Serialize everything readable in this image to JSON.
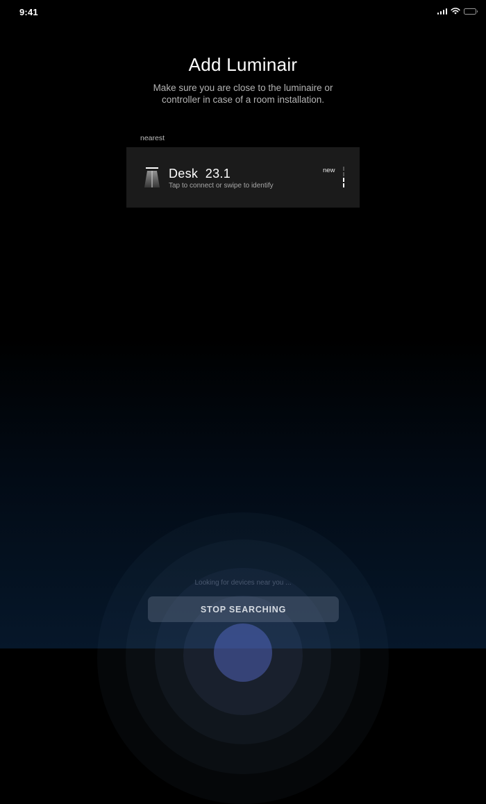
{
  "status_bar": {
    "time": "9:41",
    "icons": [
      "cellular-signal-icon",
      "wifi-icon",
      "battery-icon"
    ]
  },
  "header": {
    "title": "Add Luminair",
    "subtitle": "Make sure you are close to the luminaire or controller in case of a room installation."
  },
  "devices": {
    "section_label": "nearest",
    "items": [
      {
        "name": "Desk  23.1",
        "hint": "Tap to connect or swipe to identify",
        "badge": "new",
        "icon": "desk-lamp-icon",
        "signal_icon": "signal-strength-icon"
      }
    ]
  },
  "footer": {
    "searching_text": "Looking for devices near you ...",
    "stop_button_label": "STOP SEARCHING"
  },
  "colors": {
    "background": "#000000",
    "background_bottom": "#06172a",
    "card": "#1b1b1b",
    "button": "#3c4655",
    "ripple_core": "#5a6ed2"
  }
}
